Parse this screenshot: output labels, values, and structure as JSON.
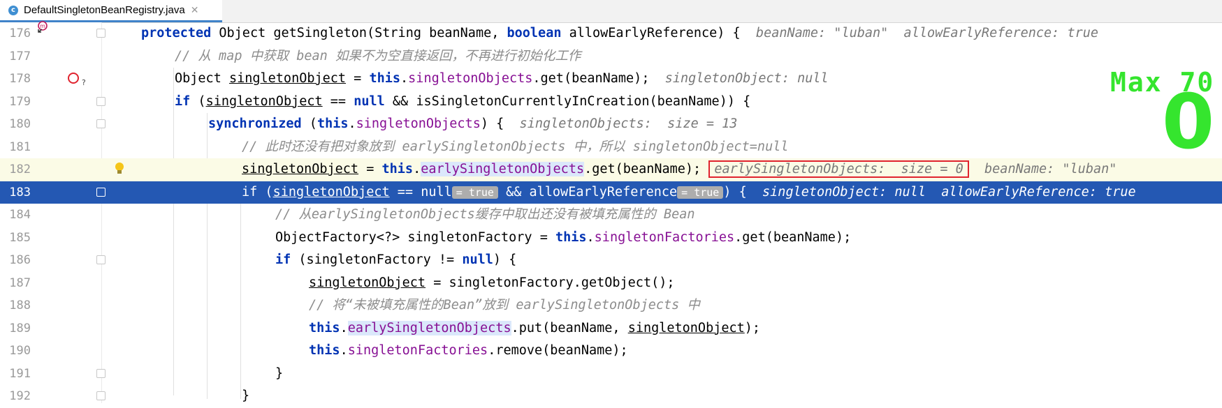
{
  "tab": {
    "filename": "DefaultSingletonBeanRegistry.java",
    "file_icon": "class-file-icon",
    "close_icon": "close-icon"
  },
  "overlay": {
    "label": "Max 70",
    "value": "0"
  },
  "lines": [
    {
      "num": "176"
    },
    {
      "num": "177"
    },
    {
      "num": "178"
    },
    {
      "num": "179"
    },
    {
      "num": "180"
    },
    {
      "num": "181"
    },
    {
      "num": "182"
    },
    {
      "num": "183"
    },
    {
      "num": "184"
    },
    {
      "num": "185"
    },
    {
      "num": "186"
    },
    {
      "num": "187"
    },
    {
      "num": "188"
    },
    {
      "num": "189"
    },
    {
      "num": "190"
    },
    {
      "num": "191"
    },
    {
      "num": "192"
    }
  ],
  "text": {
    "l176_protected": "protected",
    "l176_a": " Object getSingleton(String beanName, ",
    "l176_boolean": "boolean",
    "l176_b": " allowEarlyReference) {",
    "l176_hint": "  beanName: \"luban\"  allowEarlyReference: true",
    "l177_cmt": "// 从 map 中获取 bean 如果不为空直接返回，不再进行初始化工作",
    "l178_a": "Object ",
    "l178_var": "singletonObject",
    "l178_b": " = ",
    "l178_this": "this",
    "l178_dot": ".",
    "l178_field": "singletonObjects",
    "l178_c": ".get(beanName);",
    "l178_hint": "  singletonObject: null",
    "l179_if": "if",
    "l179_a": " (",
    "l179_var": "singletonObject",
    "l179_b": " == ",
    "l179_null": "null",
    "l179_c": " && isSingletonCurrentlyInCreation(beanName)) {",
    "l180_sync": "synchronized",
    "l180_a": " (",
    "l180_this": "this",
    "l180_dot": ".",
    "l180_field": "singletonObjects",
    "l180_b": ") {",
    "l180_hint": "  singletonObjects:  size = 13",
    "l181_cmt": "// 此时还没有把对象放到 earlySingletonObjects 中，所以 singletonObject=null",
    "l182_var": "singletonObject",
    "l182_a": " = ",
    "l182_this": "this",
    "l182_dot": ".",
    "l182_field": "earlySingletonObjects",
    "l182_b": ".get(beanName);",
    "l182_hint_box": "earlySingletonObjects:  size = 0",
    "l182_hint": "  beanName: \"luban\"",
    "l183_if": "if",
    "l183_a": " (",
    "l183_var": "singletonObject",
    "l183_b": " == ",
    "l183_null": "null",
    "l183_inl1": "= true",
    "l183_c": " && allowEarlyReference",
    "l183_inl2": "= true",
    "l183_d": ") {",
    "l183_hint": "  singletonObject: null  allowEarlyReference: true",
    "l184_cmt": "// 从earlySingletonObjects缓存中取出还没有被填充属性的 Bean",
    "l185_a": "ObjectFactory<?> singletonFactory = ",
    "l185_this": "this",
    "l185_dot": ".",
    "l185_field": "singletonFactories",
    "l185_b": ".get(beanName);",
    "l186_if": "if",
    "l186_a": " (singletonFactory != ",
    "l186_null": "null",
    "l186_b": ") {",
    "l187_var": "singletonObject",
    "l187_a": " = singletonFactory.getObject();",
    "l188_cmt": "// 将“未被填充属性的Bean”放到 earlySingletonObjects 中",
    "l189_this": "this",
    "l189_dot": ".",
    "l189_field": "earlySingletonObjects",
    "l189_a": ".put(beanName, ",
    "l189_var": "singletonObject",
    "l189_b": ");",
    "l190_this": "this",
    "l190_dot": ".",
    "l190_field": "singletonFactories",
    "l190_a": ".remove(beanName);",
    "l191_a": "}",
    "l192_a": "}"
  },
  "colors": {
    "selection": "#2458b3",
    "keyword": "#0033b3",
    "field": "#871094",
    "breakpoint_box": "#e0232e",
    "overlay": "#35e52e"
  }
}
